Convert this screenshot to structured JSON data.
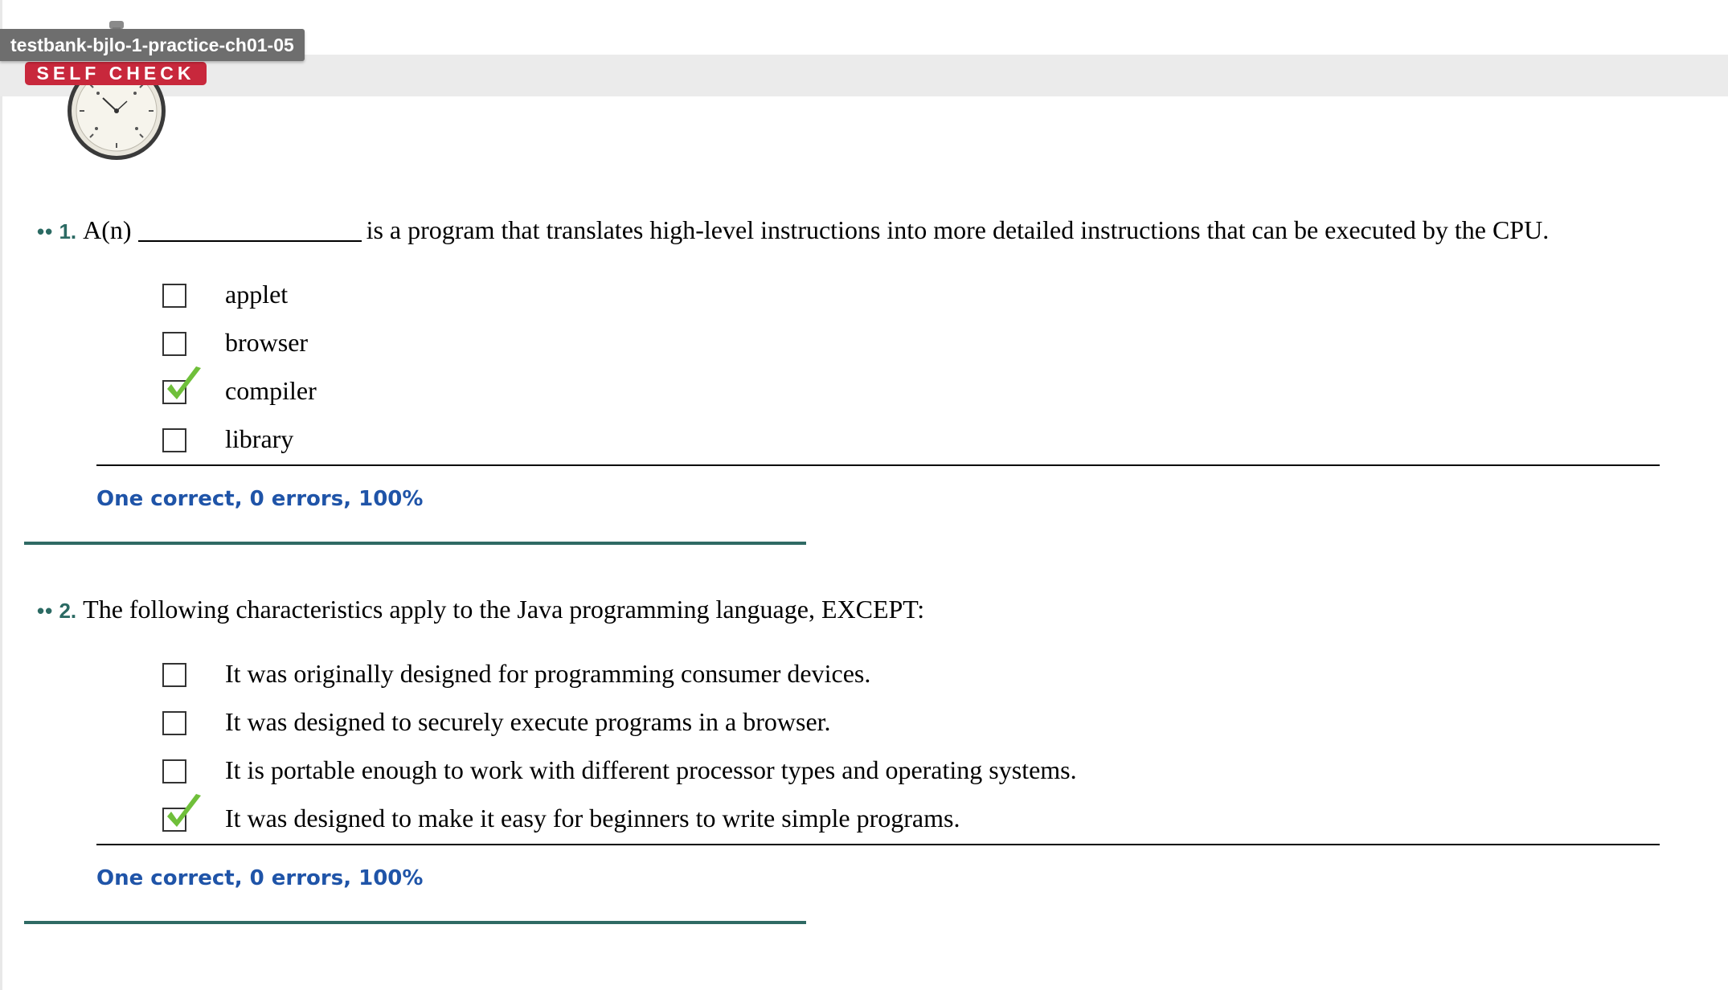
{
  "window": {
    "tab_title": "testbank-bjlo-1-practice-ch01-05"
  },
  "header": {
    "badge": "SELF CHECK"
  },
  "questions": [
    {
      "dots": "••",
      "number": "1.",
      "prefix": "A(n)",
      "text": "is a program that translates high-level instructions into more detailed instructions that can be executed by the CPU.",
      "options": [
        {
          "label": "applet",
          "checked": false
        },
        {
          "label": "browser",
          "checked": false
        },
        {
          "label": "compiler",
          "checked": true
        },
        {
          "label": "library",
          "checked": false
        }
      ],
      "feedback": "One correct, 0 errors, 100%"
    },
    {
      "dots": "••",
      "number": "2.",
      "text": "The following characteristics apply to the Java programming language, EXCEPT:",
      "options": [
        {
          "label": "It was originally designed for programming consumer devices.",
          "checked": false
        },
        {
          "label": "It was designed to securely execute programs in a browser.",
          "checked": false
        },
        {
          "label": "It is portable enough to work with different processor types and operating systems.",
          "checked": false
        },
        {
          "label": "It was designed to make it easy for beginners to write simple programs.",
          "checked": true
        }
      ],
      "feedback": "One correct, 0 errors, 100%"
    }
  ],
  "colors": {
    "question_number": "#2b6a63",
    "feedback": "#1f54a8",
    "checkmark": "#6fbf3a",
    "badge": "#c8283c"
  }
}
